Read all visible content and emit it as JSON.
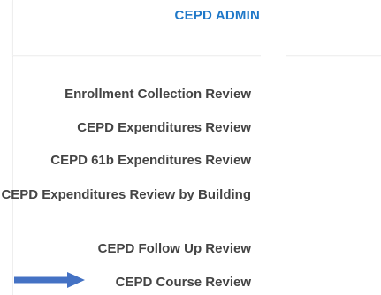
{
  "header": {
    "brand_title": "CEPD ADMIN"
  },
  "menu": {
    "items": [
      {
        "label": "Enrollment Collection Review"
      },
      {
        "label": "CEPD Expenditures Review"
      },
      {
        "label": "CEPD 61b Expenditures Review"
      },
      {
        "label": "CEPD Expenditures Review by Building"
      },
      {
        "label": "CEPD Follow Up Review"
      },
      {
        "label": "CEPD Course Review"
      }
    ]
  },
  "colors": {
    "brand": "#1f78c8",
    "menu_text": "#444444",
    "arrow": "#4472c4"
  },
  "icons": {
    "pointer": "right-arrow-icon"
  }
}
